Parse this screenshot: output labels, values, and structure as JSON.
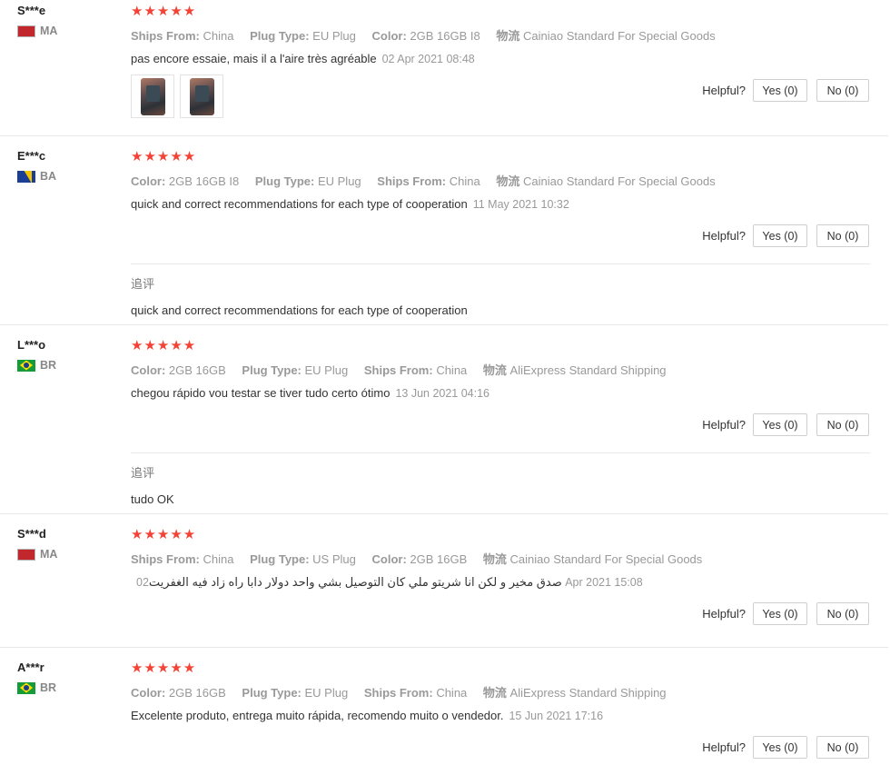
{
  "helpful_label": "Helpful?",
  "followup_title": "追评",
  "stars": "★★★★★",
  "reviews": [
    {
      "user": "S***e",
      "country": "MA",
      "flag": "ma",
      "attrs": [
        {
          "k": "Ships From:",
          "v": "China"
        },
        {
          "k": "Plug Type:",
          "v": "EU Plug"
        },
        {
          "k": "Color:",
          "v": "2GB 16GB I8"
        },
        {
          "k": "物流",
          "v": "Cainiao Standard For Special Goods"
        }
      ],
      "text": "pas encore essaie, mais il a l'aire très agréable",
      "date": "02 Apr 2021 08:48",
      "images": [
        "photo-1",
        "photo-2"
      ],
      "yes": "Yes (0)",
      "no": "No (0)"
    },
    {
      "user": "E***c",
      "country": "BA",
      "flag": "ba",
      "attrs": [
        {
          "k": "Color:",
          "v": "2GB 16GB I8"
        },
        {
          "k": "Plug Type:",
          "v": "EU Plug"
        },
        {
          "k": "Ships From:",
          "v": "China"
        },
        {
          "k": "物流",
          "v": "Cainiao Standard For Special Goods"
        }
      ],
      "text": "quick and correct recommendations for each type of cooperation",
      "date": "11 May 2021 10:32",
      "yes": "Yes (0)",
      "no": "No (0)",
      "followup": "quick and correct recommendations for each type of cooperation"
    },
    {
      "user": "L***o",
      "country": "BR",
      "flag": "br",
      "attrs": [
        {
          "k": "Color:",
          "v": "2GB 16GB"
        },
        {
          "k": "Plug Type:",
          "v": "EU Plug"
        },
        {
          "k": "Ships From:",
          "v": "China"
        },
        {
          "k": "物流",
          "v": "AliExpress Standard Shipping"
        }
      ],
      "text": "chegou rápido vou testar se tiver tudo certo ótimo",
      "date": "13 Jun 2021 04:16",
      "yes": "Yes (0)",
      "no": "No (0)",
      "followup": "tudo OK"
    },
    {
      "user": "S***d",
      "country": "MA",
      "flag": "ma",
      "attrs": [
        {
          "k": "Ships From:",
          "v": "China"
        },
        {
          "k": "Plug Type:",
          "v": "US Plug"
        },
        {
          "k": "Color:",
          "v": "2GB 16GB"
        },
        {
          "k": "物流",
          "v": "Cainiao Standard For Special Goods"
        }
      ],
      "text": "صدق مخير و لكن انا شريتو ملي كان التوصيل بشي واحد دولار دابا راه زاد فيه الغفريت",
      "date": "02 Apr 2021 15:08",
      "yes": "Yes (0)",
      "no": "No (0)"
    },
    {
      "user": "A***r",
      "country": "BR",
      "flag": "br",
      "attrs": [
        {
          "k": "Color:",
          "v": "2GB 16GB"
        },
        {
          "k": "Plug Type:",
          "v": "EU Plug"
        },
        {
          "k": "Ships From:",
          "v": "China"
        },
        {
          "k": "物流",
          "v": "AliExpress Standard Shipping"
        }
      ],
      "text": "Excelente produto, entrega muito rápida, recomendo muito o vendedor.",
      "date": "15 Jun 2021 17:16",
      "yes": "Yes (0)",
      "no": "No (0)"
    }
  ]
}
